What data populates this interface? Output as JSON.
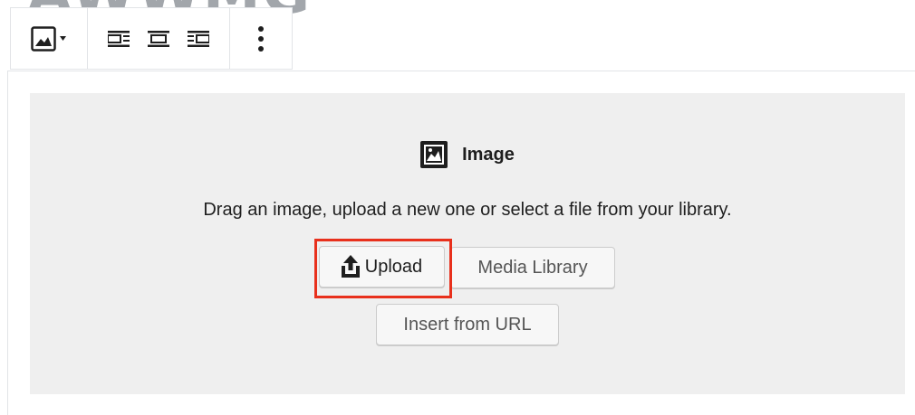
{
  "background_title": "AWWMG",
  "toolbar": {
    "switcher_icon": "image-icon",
    "dropdown_icon": "caret-down-icon",
    "align_left_icon": "align-left-icon",
    "align_center_icon": "align-center-icon",
    "align_right_icon": "align-right-icon",
    "more_icon": "more-vertical-icon"
  },
  "placeholder": {
    "label": "Image",
    "label_icon": "image-icon",
    "instructions": "Drag an image, upload a new one or select a file from your library.",
    "upload_icon": "upload-icon",
    "upload_label": "Upload",
    "media_library_label": "Media Library",
    "insert_url_label": "Insert from URL"
  },
  "colors": {
    "highlight": "#e8301c",
    "placeholder_bg": "#efefef",
    "button_bg": "#f7f7f7",
    "border": "#e2e4e7"
  }
}
